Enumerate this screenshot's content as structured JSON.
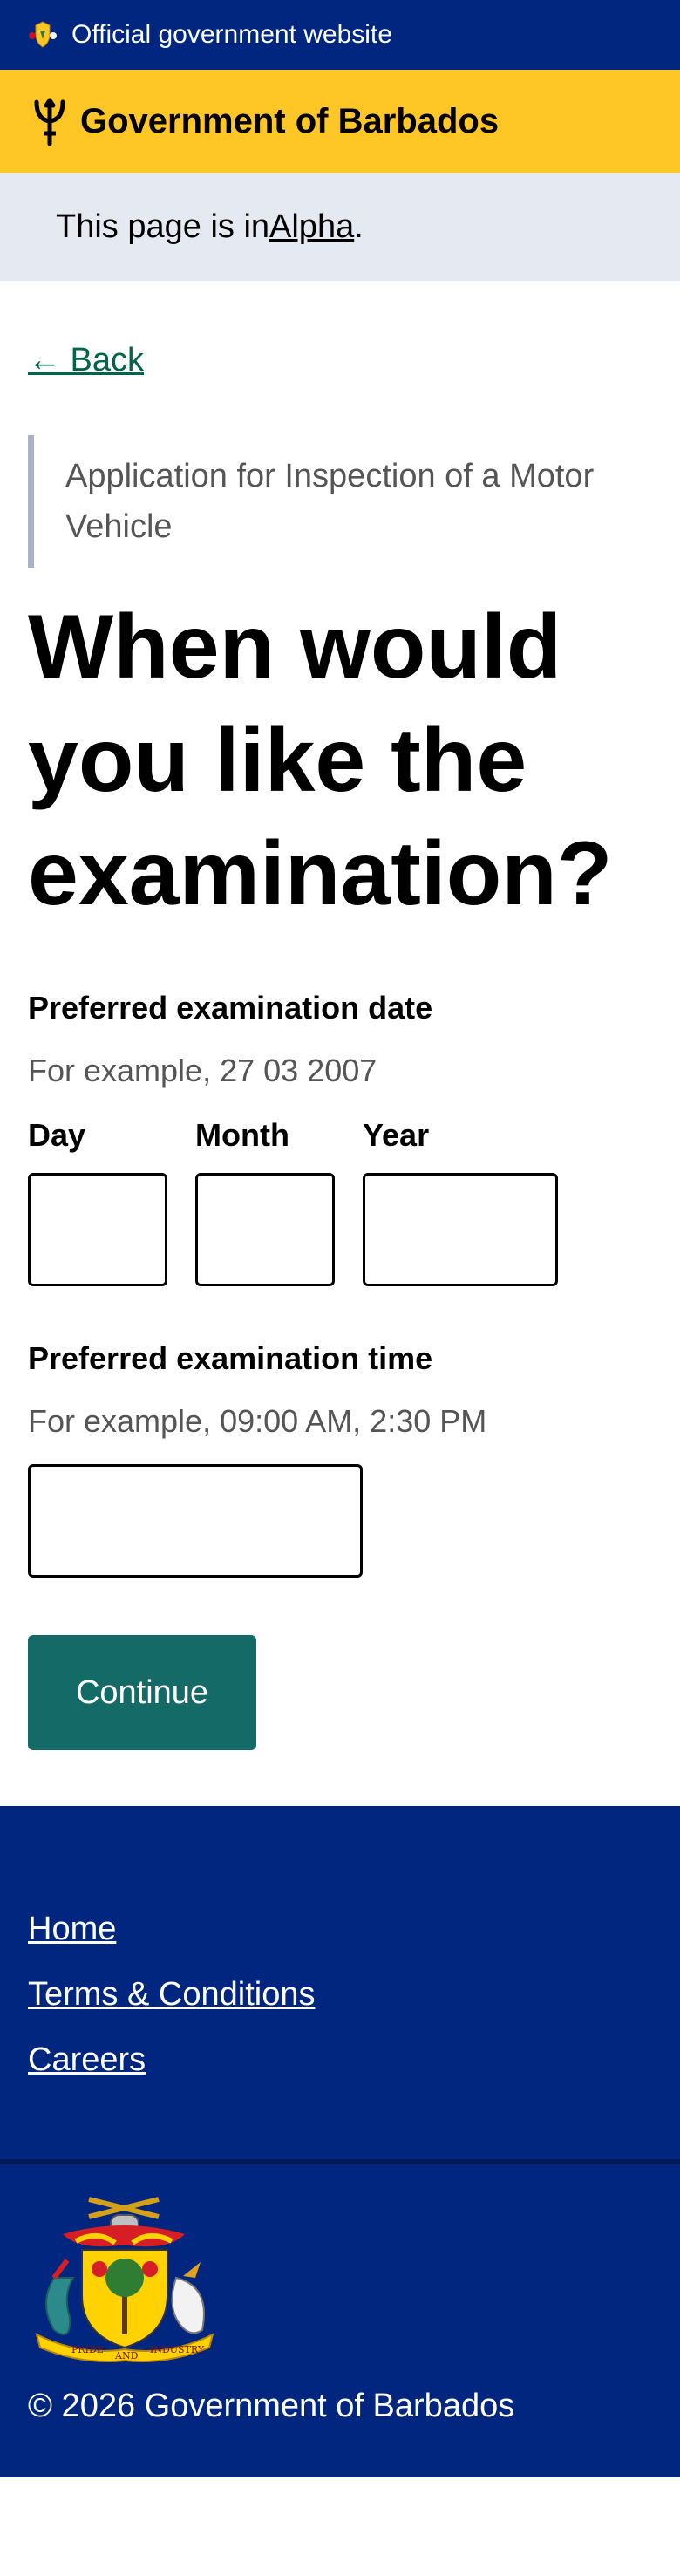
{
  "header": {
    "official_text": "Official government website",
    "brand_name": "Government of Barbados",
    "icons": {
      "crest": "barbados-crest-icon",
      "trident": "trident-icon"
    },
    "colors": {
      "official_bar": "#00267f",
      "brand_bar": "#ffc726"
    }
  },
  "banner": {
    "prefix": "This page is in ",
    "link_text": "Alpha",
    "suffix": "."
  },
  "nav": {
    "back_label": "← Back"
  },
  "form": {
    "caption": "Application for Inspection of a Motor Vehicle",
    "heading": "When would you like the examination?",
    "date": {
      "label": "Preferred examination date",
      "hint": "For example, 27 03 2007",
      "day_label": "Day",
      "month_label": "Month",
      "year_label": "Year",
      "day_value": "",
      "month_value": "",
      "year_value": ""
    },
    "time": {
      "label": "Preferred examination time",
      "hint": "For example, 09:00 AM, 2:30 PM",
      "value": ""
    },
    "continue_label": "Continue",
    "colors": {
      "button": "#136a66",
      "link": "#00654a"
    }
  },
  "footer": {
    "links": [
      "Home",
      "Terms & Conditions",
      "Careers"
    ],
    "coat_motto": [
      "PRIDE",
      "AND",
      "INDUSTRY"
    ],
    "copyright": "© 2026 Government of Barbados"
  }
}
